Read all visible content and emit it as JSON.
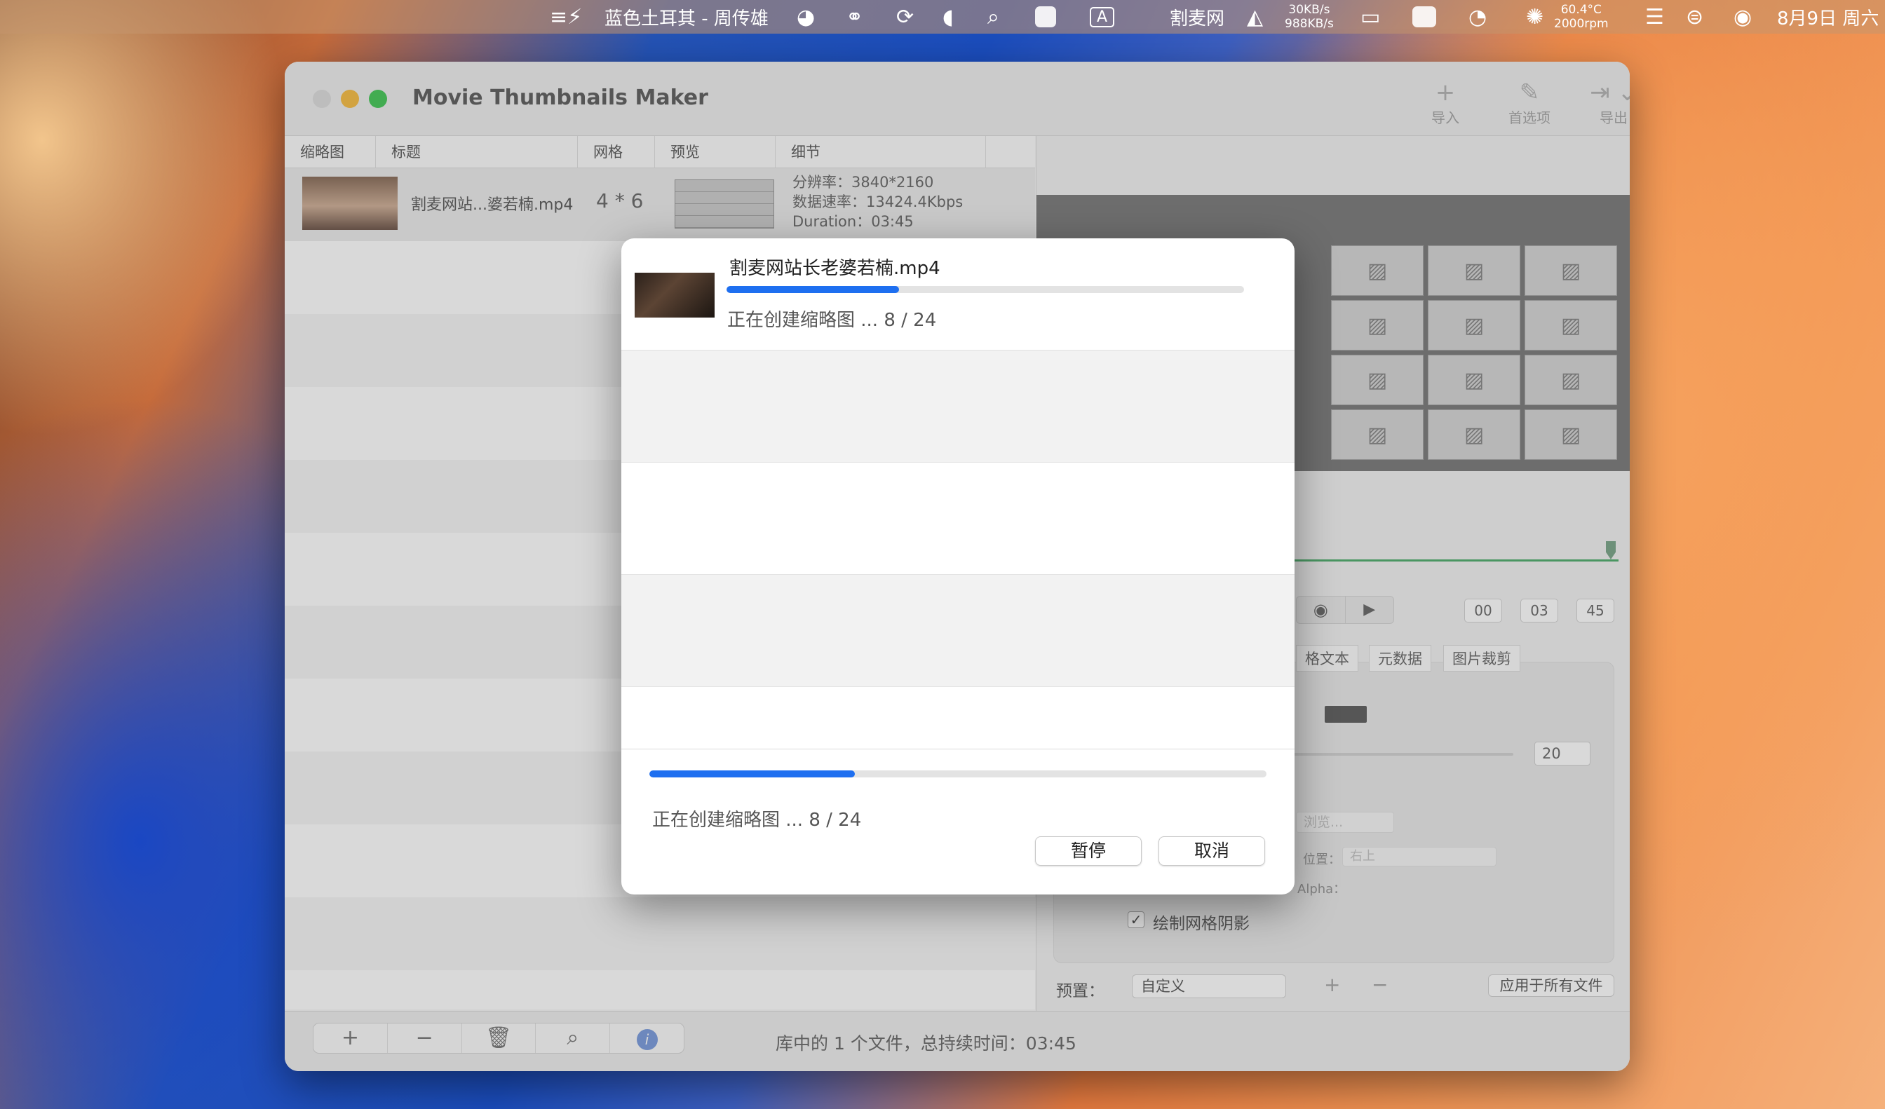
{
  "menubar": {
    "song": "蓝色土耳其 - 周传雄",
    "site": "割麦网",
    "net_up": "30KB/s",
    "net_down": "988KB/s",
    "temp": "60.4°C",
    "rpm": "2000rpm",
    "datetime": "8月9日 周六"
  },
  "window": {
    "title": "Movie Thumbnails Maker",
    "toolbar": {
      "import": "导入",
      "prefs": "首选项",
      "export": "导出"
    }
  },
  "table": {
    "columns": [
      "缩略图",
      "标题",
      "网格",
      "预览",
      "细节"
    ],
    "rows": [
      {
        "title": "割麦网站...婆若楠.mp4",
        "grid": "4 * 6",
        "details": [
          "分辨率：3840*2160",
          "数据速率：13424.4Kbps",
          "Duration：03:45"
        ]
      }
    ]
  },
  "right_panel": {
    "time": [
      "00",
      "03",
      "45"
    ],
    "tabs": [
      "格文本",
      "元数据",
      "图片裁剪"
    ],
    "value": "20",
    "browse": "浏览...",
    "position_label": "位置：",
    "position_value": "右上",
    "alpha_label": "Alpha：",
    "shadow_label": "绘制网格阴影",
    "preset_label": "预置：",
    "preset_value": "自定义",
    "apply_all": "应用于所有文件"
  },
  "bottom": {
    "status": "库中的 1 个文件，总持续时间：03:45"
  },
  "dialog": {
    "file": "割麦网站长老婆若楠.mp4",
    "file_progress": 0.333,
    "file_status": "正在创建缩略图 ... 8 / 24",
    "overall_progress": 0.333,
    "overall_status": "正在创建缩略图 ... 8 / 24",
    "pause": "暂停",
    "cancel": "取消"
  }
}
